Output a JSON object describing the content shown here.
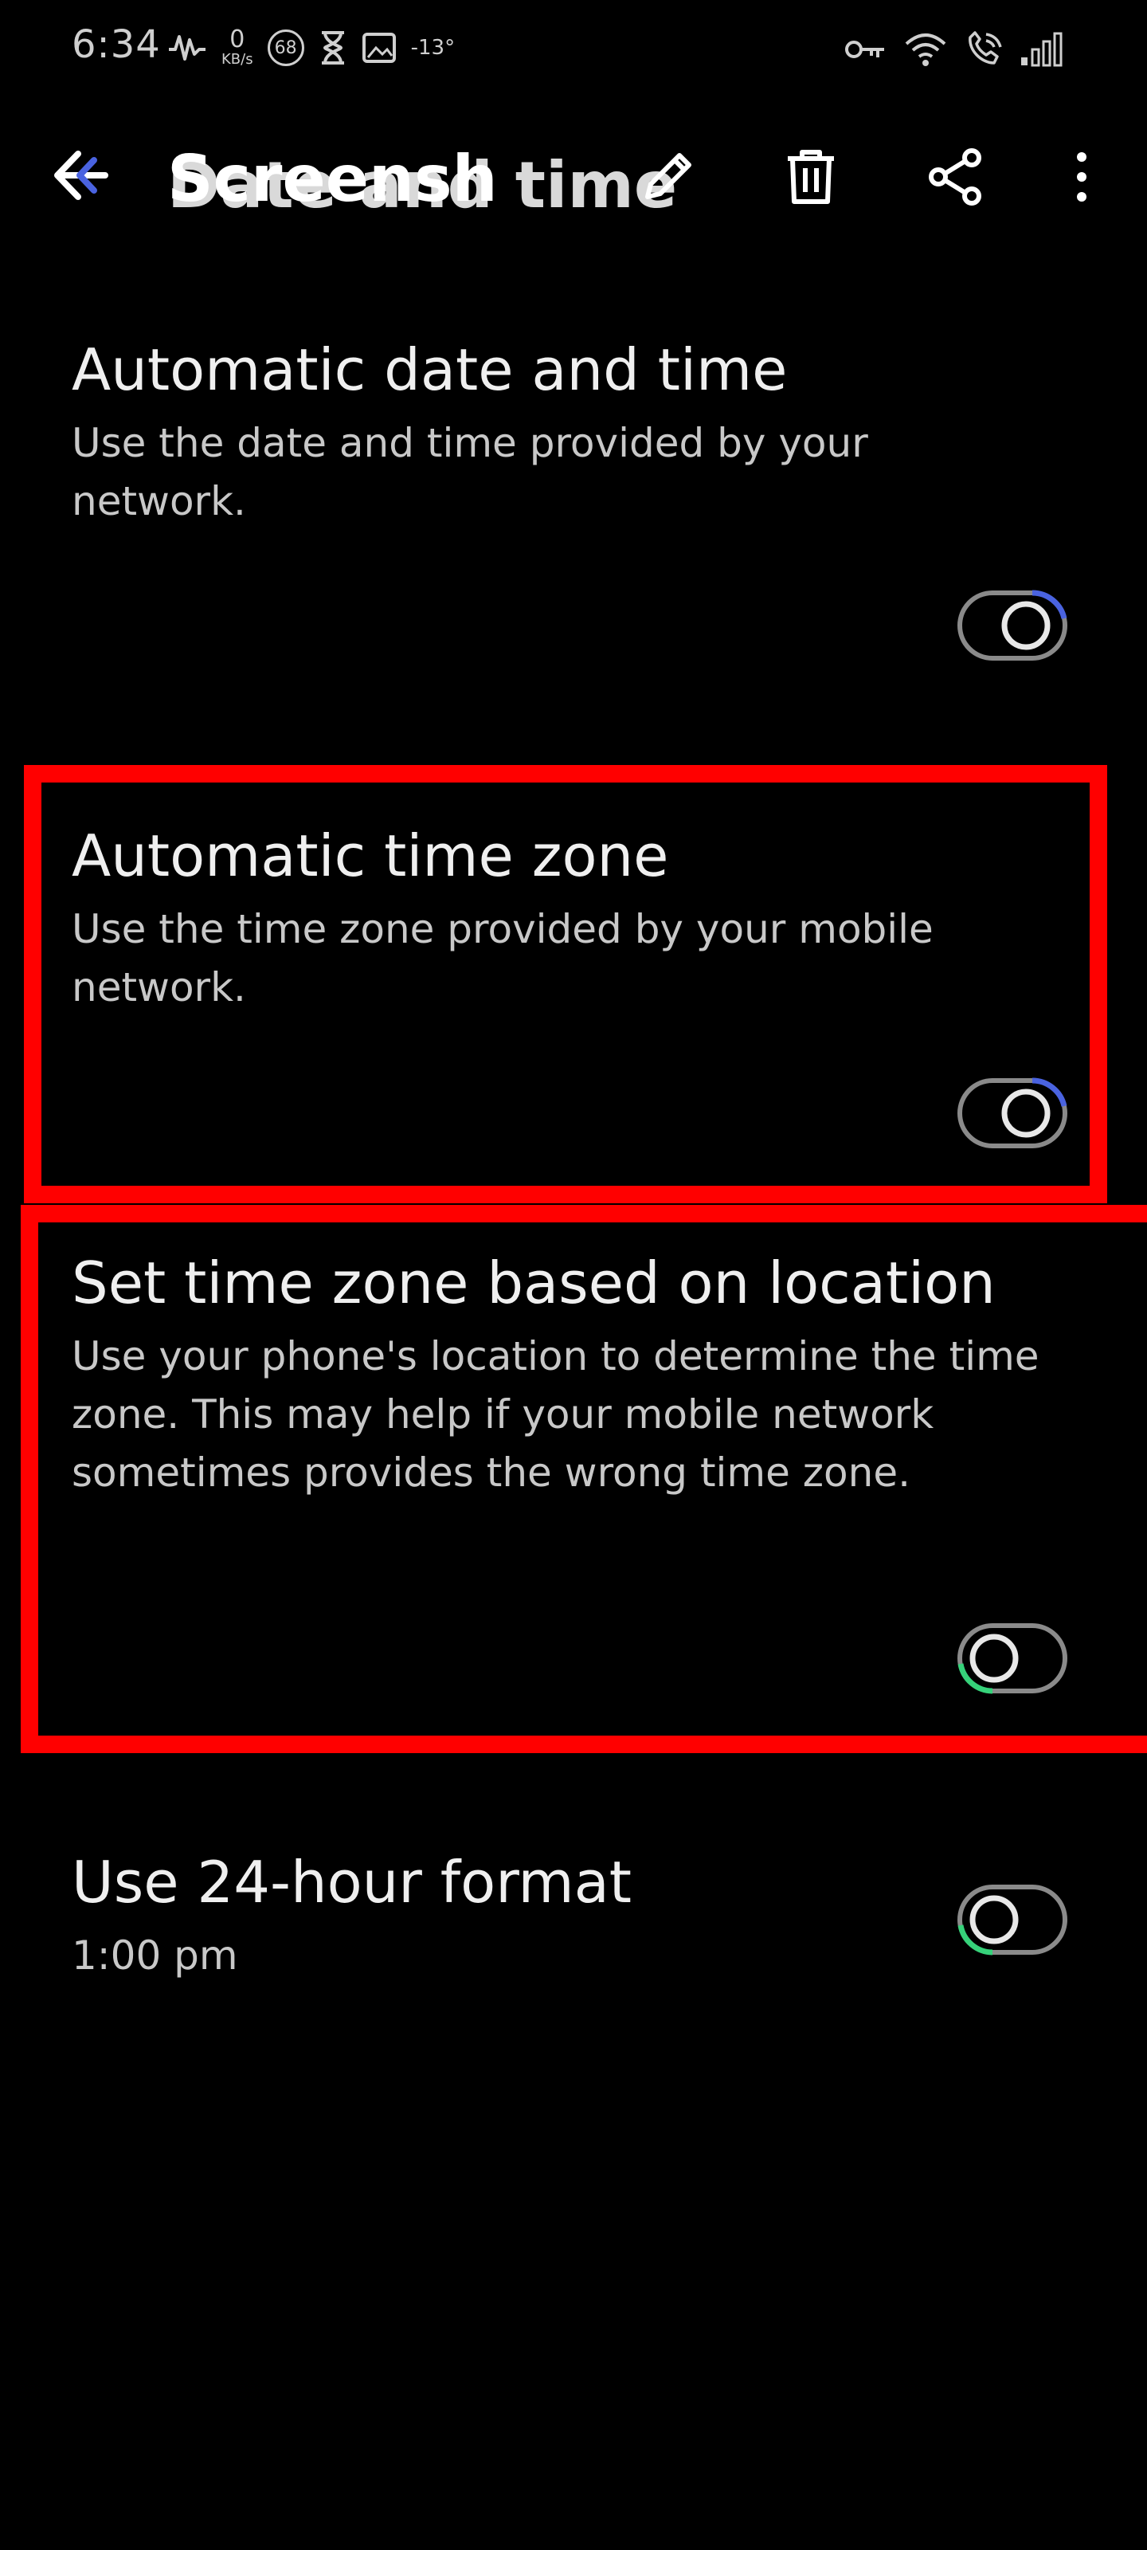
{
  "status_bar": {
    "time": "6:34",
    "net_speed_value": "0",
    "net_speed_unit": "KB/s",
    "badge": "68",
    "temperature": "-13°"
  },
  "header": {
    "title": "Date and time",
    "overlay_title": "Screensh"
  },
  "settings": [
    {
      "title": "Automatic date and time",
      "subtitle": "Use the date and time provided by your network.",
      "toggle_accent": "#4a63e0"
    },
    {
      "title": "Automatic time zone",
      "subtitle": "Use the time zone provided by your mobile network.",
      "toggle_accent": "#4a63e0"
    },
    {
      "title": "Set time zone based on location",
      "subtitle": "Use your phone's location to determine the time zone. This may help if your mobile network sometimes provides the wrong time zone.",
      "toggle_accent": "#36d27a"
    },
    {
      "title": "Use 24-hour format",
      "subtitle": "1:00 pm",
      "toggle_accent": "#36d27a"
    }
  ],
  "icons": {
    "back": "back-arrow-icon",
    "edit": "pencil-icon",
    "delete": "trash-icon",
    "share": "share-icon",
    "more": "more-vertical-icon"
  },
  "colors": {
    "background": "#000000",
    "highlight": "#ff0000"
  }
}
